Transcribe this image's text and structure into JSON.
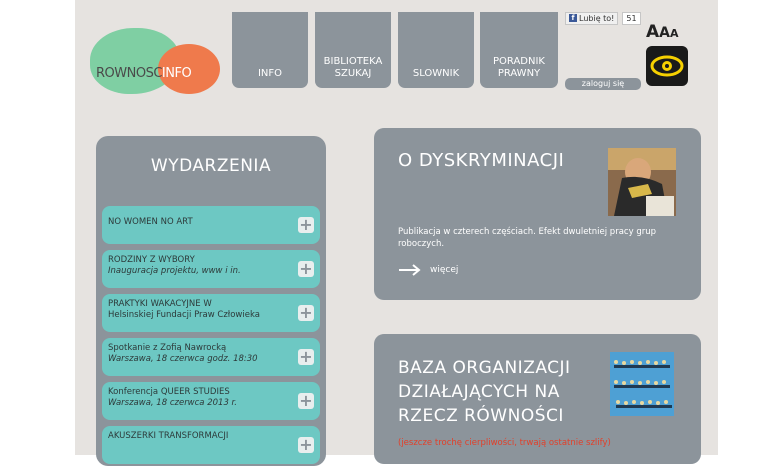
{
  "header": {
    "logo": {
      "text_main": "ROWNOSC",
      "text_accent": "INFO"
    },
    "tabs": [
      {
        "label": "INFO"
      },
      {
        "label": "BIBLIOTEKA\nSZUKAJ"
      },
      {
        "label": "SLOWNIK"
      },
      {
        "label": "PORADNIK\nPRAWNY"
      }
    ],
    "facebook": {
      "like_label": "Lubię to!",
      "count": "51"
    },
    "login_label": "zaloguj się",
    "font_size_controls": [
      "A",
      "A",
      "A"
    ],
    "accessibility_icon": "eye-icon"
  },
  "events": {
    "title": "WYDARZENIA",
    "items": [
      {
        "title": "NO WOMEN NO ART",
        "sub": ""
      },
      {
        "title": "RODZINY Z WYBORY",
        "sub": "Inauguracja projektu, www i in."
      },
      {
        "title": "PRAKTYKI WAKACYJNE W",
        "sub": "Helsinskiej Fundacji Praw Człowieka"
      },
      {
        "title": "Spotkanie z Zofią Nawrocką",
        "sub": "Warszawa, 18 czerwca godz. 18:30"
      },
      {
        "title": "Konferencja QUEER STUDIES",
        "sub": "Warszawa, 18 czerwca 2013 r."
      },
      {
        "title": "AKUSZERKI TRANSFORMACJI",
        "sub": ""
      }
    ]
  },
  "cards": {
    "discrimination": {
      "title": "O DYSKRYMINACJI",
      "body": "Publikacja w czterech częściach. Efekt dwuletniej pracy grup roboczych.",
      "more": "więcej"
    },
    "organizations": {
      "title_lines": [
        "BAZA ORGANIZACJI",
        "DZIAŁAJĄCYCH NA",
        "RZECZ RÓWNOŚCI"
      ],
      "note": "(jeszcze trochę cierpliwości, trwają ostatnie szlify)"
    }
  },
  "colors": {
    "background": "#e6e3e0",
    "tab": "#8c949b",
    "event_item": "#6dc8c3",
    "logo_green": "#7fcfa3",
    "logo_red": "#ef7a4c",
    "note_red": "#e1402a"
  }
}
